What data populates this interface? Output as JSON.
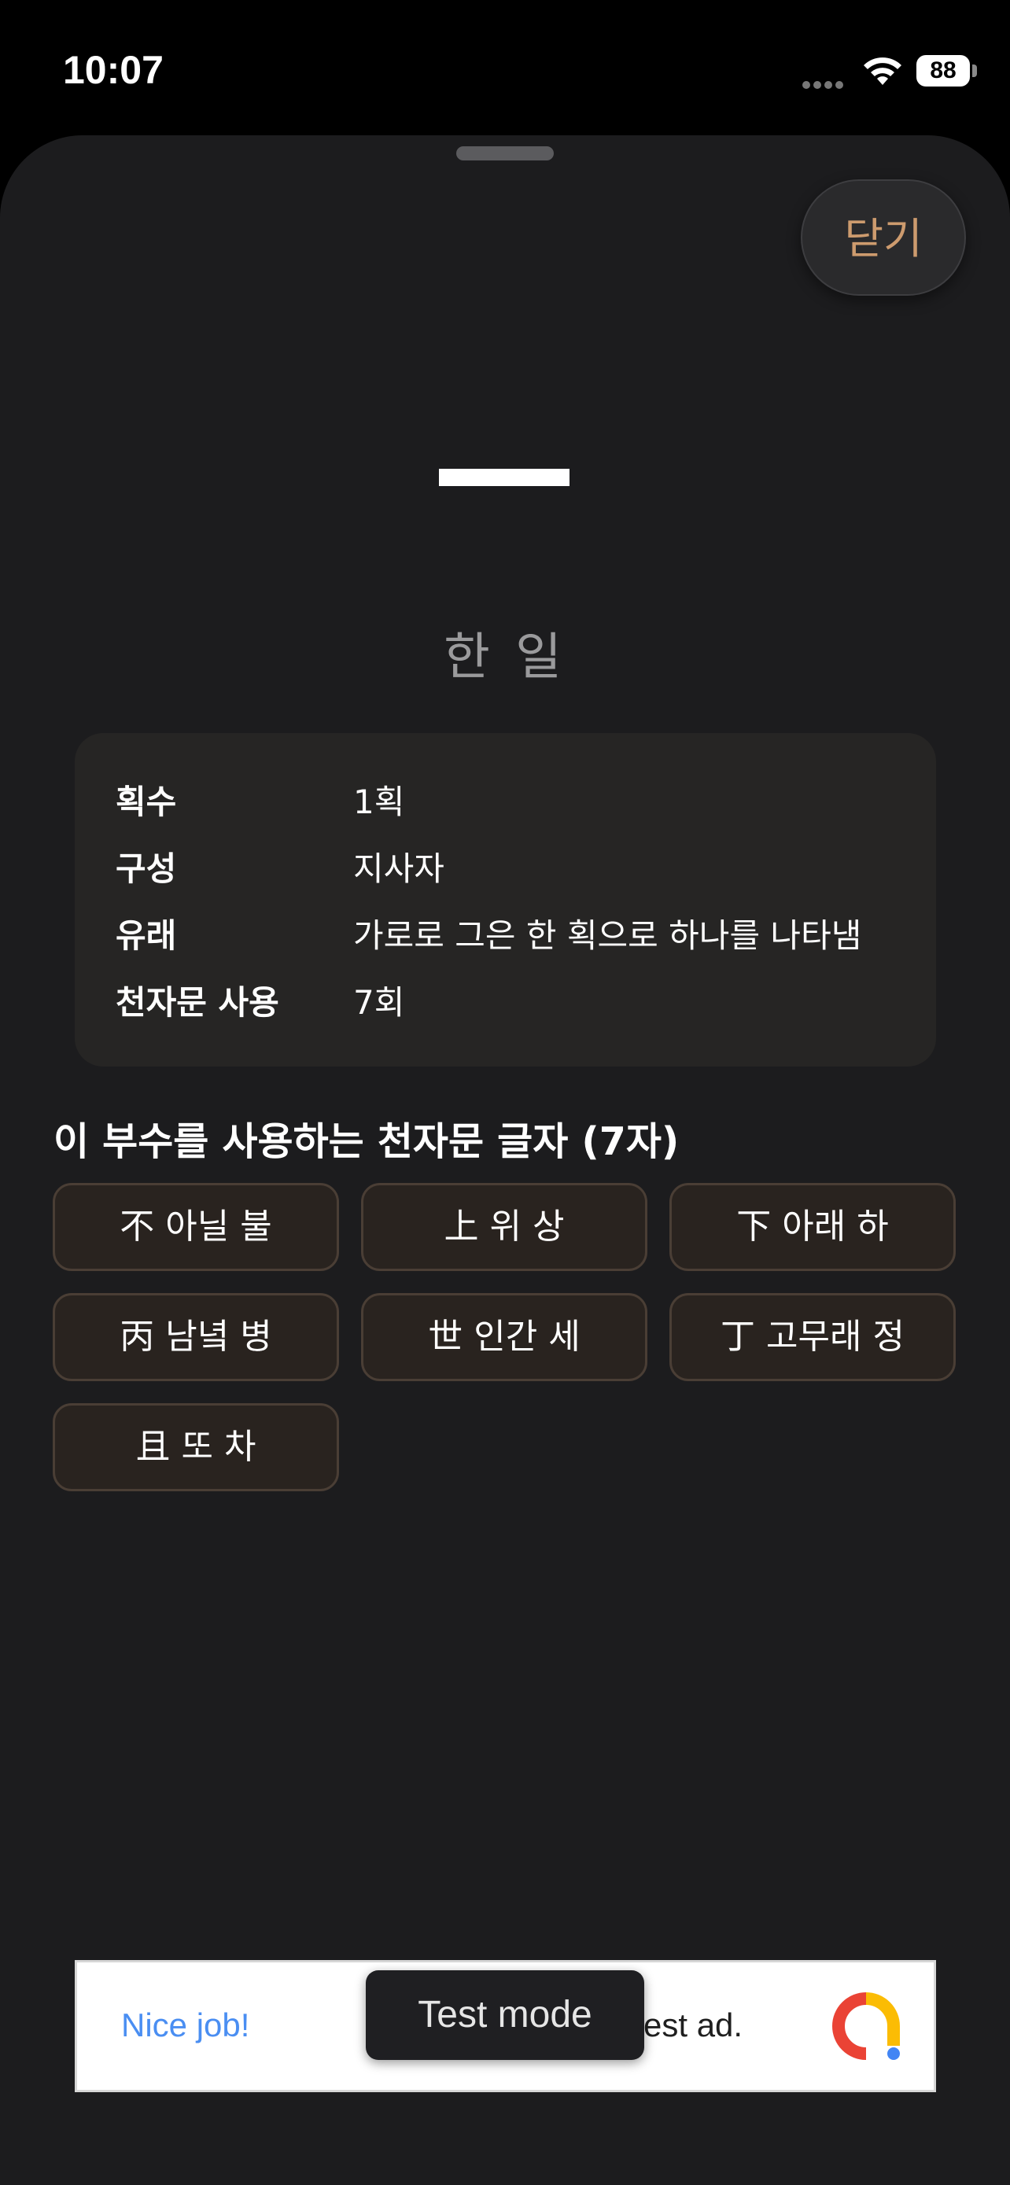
{
  "status_bar": {
    "time": "10:07",
    "battery": "88",
    "icons": [
      "signal-dots-icon",
      "wifi-icon",
      "battery-charging-icon"
    ]
  },
  "sheet": {
    "close_label": "닫기",
    "hanja_glyph_icon": "one-stroke-hanja-glyph",
    "meaning": "한 일",
    "info": [
      {
        "label": "획수",
        "value": "1획"
      },
      {
        "label": "구성",
        "value": "지사자"
      },
      {
        "label": "유래",
        "value": "가로로 그은 한 획으로 하나를 나타냄"
      },
      {
        "label": "천자문 사용",
        "value": "7회"
      }
    ],
    "section_title": "이 부수를 사용하는 천자문 글자 (7자)",
    "characters": [
      "不 아닐 불",
      "上 위 상",
      "下 아래 하",
      "丙 남녘 병",
      "世 인간 세",
      "丁 고무래 정",
      "且 또 차"
    ]
  },
  "ad": {
    "left_text": "Nice job!",
    "right_text": "est ad.",
    "toast": "Test mode",
    "logo_icon": "admob-logo-icon"
  },
  "colors": {
    "sheet_bg": "#1c1c1e",
    "accent": "#cd9b6e",
    "chip_bg": "#29231f",
    "chip_border": "#4a3e35",
    "card_bg": "#262524"
  }
}
